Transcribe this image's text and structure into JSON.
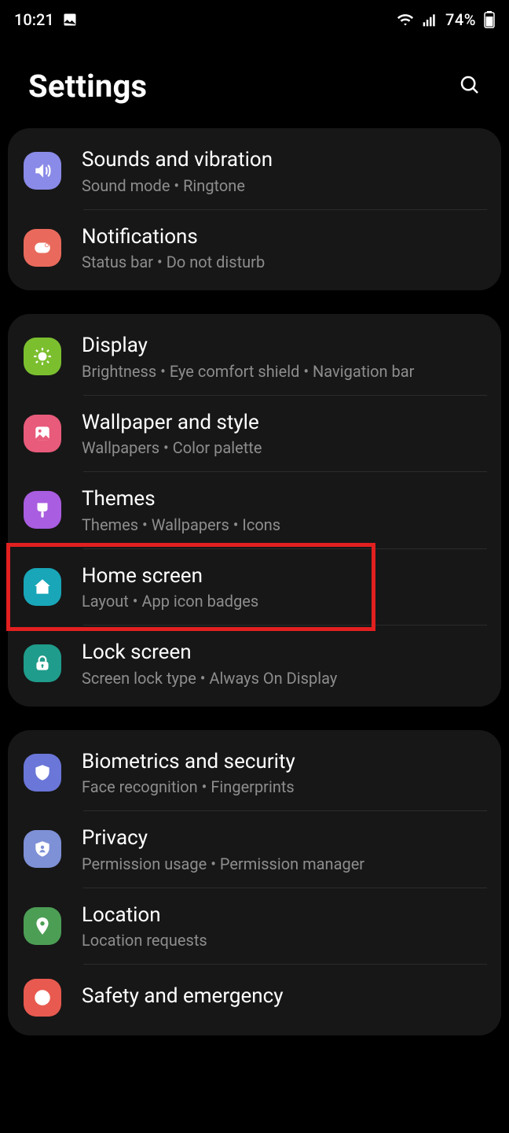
{
  "status": {
    "time": "10:21",
    "battery_percent": "74%"
  },
  "header": {
    "title": "Settings"
  },
  "groups": [
    {
      "items": [
        {
          "icon": "speaker-icon",
          "icon_bg": "bg-violet",
          "title": "Sounds and vibration",
          "sub": "Sound mode  •  Ringtone"
        },
        {
          "icon": "bell-icon",
          "icon_bg": "bg-coral",
          "title": "Notifications",
          "sub": "Status bar  •  Do not disturb"
        }
      ]
    },
    {
      "items": [
        {
          "icon": "sun-icon",
          "icon_bg": "bg-green",
          "title": "Display",
          "sub": "Brightness  •  Eye comfort shield  •  Navigation bar"
        },
        {
          "icon": "picture-icon",
          "icon_bg": "bg-pink",
          "title": "Wallpaper and style",
          "sub": "Wallpapers  •  Color palette"
        },
        {
          "icon": "brush-icon",
          "icon_bg": "bg-purple",
          "title": "Themes",
          "sub": "Themes  •  Wallpapers  •  Icons"
        },
        {
          "icon": "home-icon",
          "icon_bg": "bg-teal",
          "title": "Home screen",
          "sub": "Layout  •  App icon badges",
          "highlight": true
        },
        {
          "icon": "lock-icon",
          "icon_bg": "bg-teal2",
          "title": "Lock screen",
          "sub": "Screen lock type  •  Always On Display"
        }
      ]
    },
    {
      "items": [
        {
          "icon": "shield-icon",
          "icon_bg": "bg-indigo",
          "title": "Biometrics and security",
          "sub": "Face recognition  •  Fingerprints"
        },
        {
          "icon": "privacy-icon",
          "icon_bg": "bg-slateblue",
          "title": "Privacy",
          "sub": "Permission usage  •  Permission manager"
        },
        {
          "icon": "location-icon",
          "icon_bg": "bg-olive",
          "title": "Location",
          "sub": "Location requests"
        },
        {
          "icon": "sos-icon",
          "icon_bg": "bg-red",
          "title": "Safety and emergency",
          "sub": ""
        }
      ]
    }
  ]
}
